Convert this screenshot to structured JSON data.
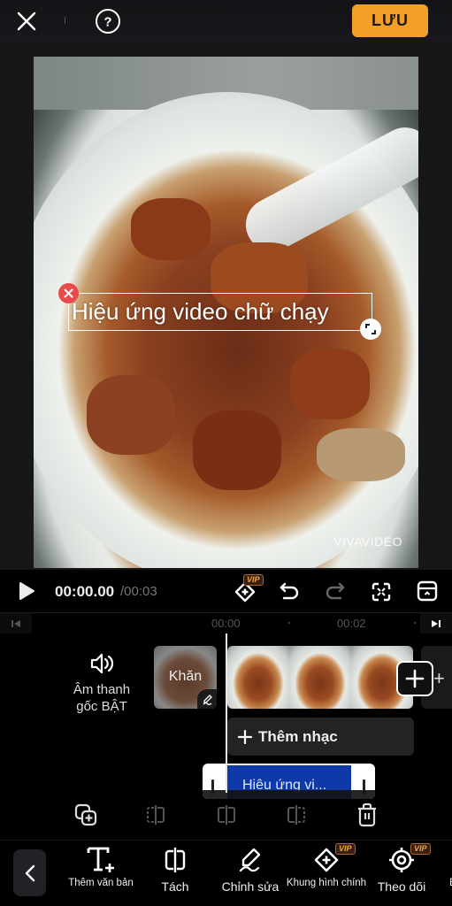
{
  "header": {
    "close_icon": "close-icon",
    "help_icon": "help-circle-icon",
    "save_label": "LƯU"
  },
  "preview": {
    "overlay_text": "Hiệu ứng video chữ chạy",
    "watermark": "VIVAVIDEO",
    "delete_icon": "close-icon",
    "resize_icon": "resize-icon"
  },
  "playback": {
    "current_time": "00:00.00",
    "total_time": "/00:03",
    "vip_badge": "VIP",
    "icons": [
      "play-icon",
      "keyframe-icon",
      "undo-icon",
      "redo-icon",
      "fullscreen-icon",
      "panel-collapse-icon"
    ]
  },
  "ruler": {
    "ticks": [
      "00:00",
      "00:02"
    ]
  },
  "timeline": {
    "audio_label_line1": "Âm thanh",
    "audio_label_line2": "gốc BẬT",
    "cover_label": "Khăn",
    "add_music_label": "Thêm nhạc",
    "text_track_label": "Hiệu ứng vi..."
  },
  "clip_actions": [
    "duplicate-icon",
    "split-left-icon",
    "split-icon",
    "split-right-icon",
    "delete-icon"
  ],
  "bottom_nav": {
    "items": [
      {
        "label": "Thêm văn bản",
        "icon": "add-text-icon",
        "vip": false
      },
      {
        "label": "Tách",
        "icon": "split-icon",
        "vip": false
      },
      {
        "label": "Chỉnh sửa",
        "icon": "edit-pen-icon",
        "vip": false
      },
      {
        "label": "Khung hình chính",
        "icon": "keyframe-icon",
        "vip": true
      },
      {
        "label": "Theo dõi",
        "icon": "tracking-icon",
        "vip": true
      },
      {
        "label": "B",
        "icon": "",
        "vip": false
      }
    ],
    "vip_badge": "VIP"
  },
  "colors": {
    "accent": "#f3a02b",
    "text_track": "#0d3aa8",
    "delete_red": "#e84b4b"
  }
}
